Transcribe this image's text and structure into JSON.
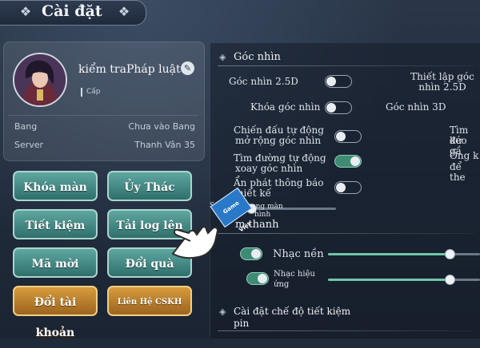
{
  "header": {
    "title": "Cài đặt"
  },
  "profile": {
    "name": "kiểm traPháp luật",
    "level_label": "Cấp",
    "guild_label": "Bang",
    "guild_value": "Chưa vào Bang",
    "server_label": "Server",
    "server_value": "Thanh Vân 35"
  },
  "buttons": {
    "lock_screen": "Khóa màn hình",
    "auto_offline": "Ủy Thác Offline",
    "save_battery": "Tiết kiệm pin",
    "upload_log": "Tải log lên",
    "invite_code": "Mã mời",
    "redeem": "Đổi quà",
    "switch_account": "Đổi tài khoản",
    "contact_support": "Liên Hệ CSKH"
  },
  "camera": {
    "section_title": "Góc nhìn",
    "view_25d": "Góc nhìn 2.5D",
    "setup_25d": "Thiết lập góc nhìn 2.5D",
    "lock_view": "Khóa góc nhìn",
    "view_3d": "Góc nhìn 3D",
    "auto_fight_line1": "Chiến đấu tự động",
    "auto_fight_line2": "mở rộng góc nhìn",
    "auto_path_line1": "Tìm đường tự động",
    "auto_path_line2": "xoay góc nhìn",
    "hide_notice_line1": "Ẩn phát thông báo",
    "hide_notice_line2": "thiết kế",
    "right_clip_1": "Tìm đư",
    "right_clip_2": "kéo gầ",
    "right_clip_3": "Ống k",
    "right_clip_4": "để the",
    "slider_label_left": "Số",
    "slider_label_right_1": "hung màn",
    "slider_label_right_2": "hình",
    "sticker": "Game Việt",
    "toggles": {
      "view_25d": false,
      "lock_view": false,
      "auto_fight": false,
      "auto_path": true,
      "hide_notice": false
    },
    "slider_level": 0.12
  },
  "sound": {
    "section_title": "m thanh",
    "music": "Nhạc nền",
    "sfx_line1": "Nhạc hiệu",
    "sfx_line2": "ứng",
    "music_level": 0.8,
    "sfx_level": 0.8
  },
  "battery": {
    "section_title_line1": "Cài đặt chế độ tiết kiệm",
    "section_title_line2": "pin"
  },
  "icons": {
    "title_left": "ornament-icon",
    "title_right": "ornament-icon",
    "edit": "pencil-icon",
    "hand": "pointing-hand-icon"
  }
}
